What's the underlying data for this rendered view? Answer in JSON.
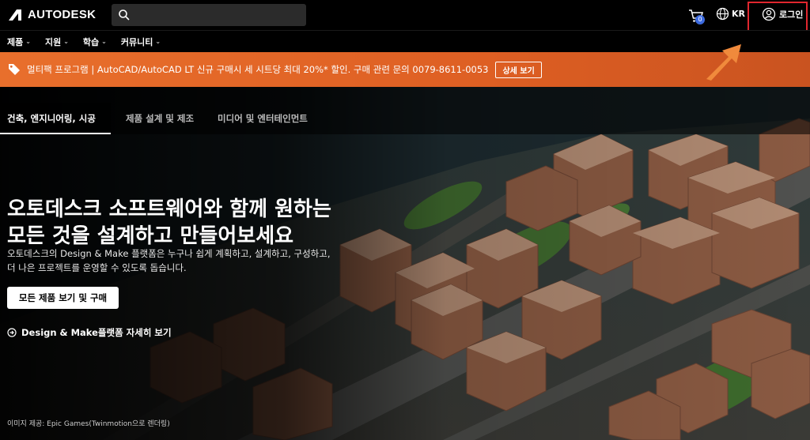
{
  "brand": {
    "name": "AUTODESK"
  },
  "header": {
    "search_placeholder": "",
    "cart_count": "0",
    "language": "KR",
    "login_label": "로그인"
  },
  "nav": {
    "items": [
      {
        "label": "제품"
      },
      {
        "label": "지원"
      },
      {
        "label": "학습"
      },
      {
        "label": "커뮤니티"
      }
    ]
  },
  "promo": {
    "text": "멀티팩 프로그램 | AutoCAD/AutoCAD LT 신규 구매시 세 시트당 최대 20%* 할인. 구매 관련 문의 0079-8611-0053",
    "button_label": "상세 보기"
  },
  "hero": {
    "tabs": [
      {
        "label": "건축, 엔지니어링, 시공",
        "active": true
      },
      {
        "label": "제품 설계 및 제조",
        "active": false
      },
      {
        "label": "미디어 및 엔터테인먼트",
        "active": false
      }
    ],
    "headline_line1": "오토데스크 소프트웨어와 함께 원하는",
    "headline_line2": "모든 것을 설계하고 만들어보세요",
    "desc_line1": "오토데스크의 Design & Make 플랫폼은 누구나 쉽게 계획하고, 설계하고, 구성하고,",
    "desc_line2": "더 나은 프로젝트를 운영할 수 있도록 돕습니다.",
    "cta_label": "모든 제품 보기 및 구매",
    "learn_label": "Design & Make플랫폼 자세히 보기",
    "credit": "이미지 제공: Epic Games(Twinmotion으로 렌더링)"
  },
  "colors": {
    "promo_bg": "#e0652a",
    "highlight": "#e0262e",
    "arrow": "#f08a3c",
    "badge": "#3d6be0"
  }
}
